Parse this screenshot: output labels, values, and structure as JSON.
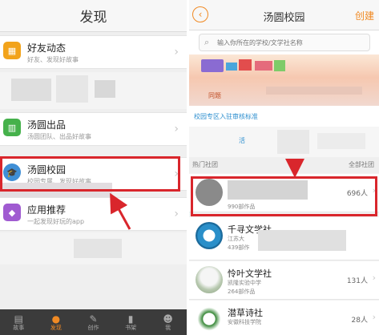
{
  "left_screen": {
    "title": "发现",
    "rows": [
      {
        "title": "好友动态",
        "subtitle": "好友、发现好故事",
        "icon": "friends-icon",
        "icon_color": "#f2a31b"
      },
      {
        "title": "汤圆出品",
        "subtitle": "汤圆团队、出品好故事",
        "icon": "book-icon",
        "icon_color": "#45b14b"
      },
      {
        "title": "汤圆校园",
        "subtitle": "校园专属、发现好故事",
        "icon": "graduation-cap-icon",
        "icon_color": "#3f8fd6"
      },
      {
        "title": "应用推荐",
        "subtitle": "一起发现好玩的app",
        "icon": "tag-icon",
        "icon_color": "#a05bd1"
      }
    ],
    "tabs": [
      {
        "label": "故事",
        "icon": "story-icon",
        "active": false
      },
      {
        "label": "发现",
        "icon": "location-pin-icon",
        "active": true
      },
      {
        "label": "创作",
        "icon": "pen-icon",
        "active": false
      },
      {
        "label": "书架",
        "icon": "bookshelf-icon",
        "active": false
      },
      {
        "label": "我",
        "icon": "person-icon",
        "active": false
      }
    ]
  },
  "right_screen": {
    "back_icon": "chevron-left-icon",
    "title": "汤圆校园",
    "action": "创建",
    "search_placeholder": "输入你所在的学校/文学社名称",
    "banner_caption": "同题",
    "blue_link": "校园专区入驻审核标准",
    "section_tag": "活",
    "hot_label": "热门社团",
    "all_label": "全部社团",
    "clubs": [
      {
        "name": "",
        "line1": "",
        "line2": "990部作品",
        "count": "696人"
      },
      {
        "name": "千寻文学社",
        "line1": "江苏大",
        "line2": "439部作",
        "count": ""
      },
      {
        "name": "怜叶文学社",
        "line1": "凯隆实验中学",
        "line2": "264部作品",
        "count": "131人"
      },
      {
        "name": "潜草诗社",
        "line1": "安徽科技学院",
        "line2": "",
        "count": "28人"
      }
    ]
  },
  "colors": {
    "accent": "#f08a24",
    "annotation": "#d9262c",
    "link": "#2e8fcf"
  }
}
